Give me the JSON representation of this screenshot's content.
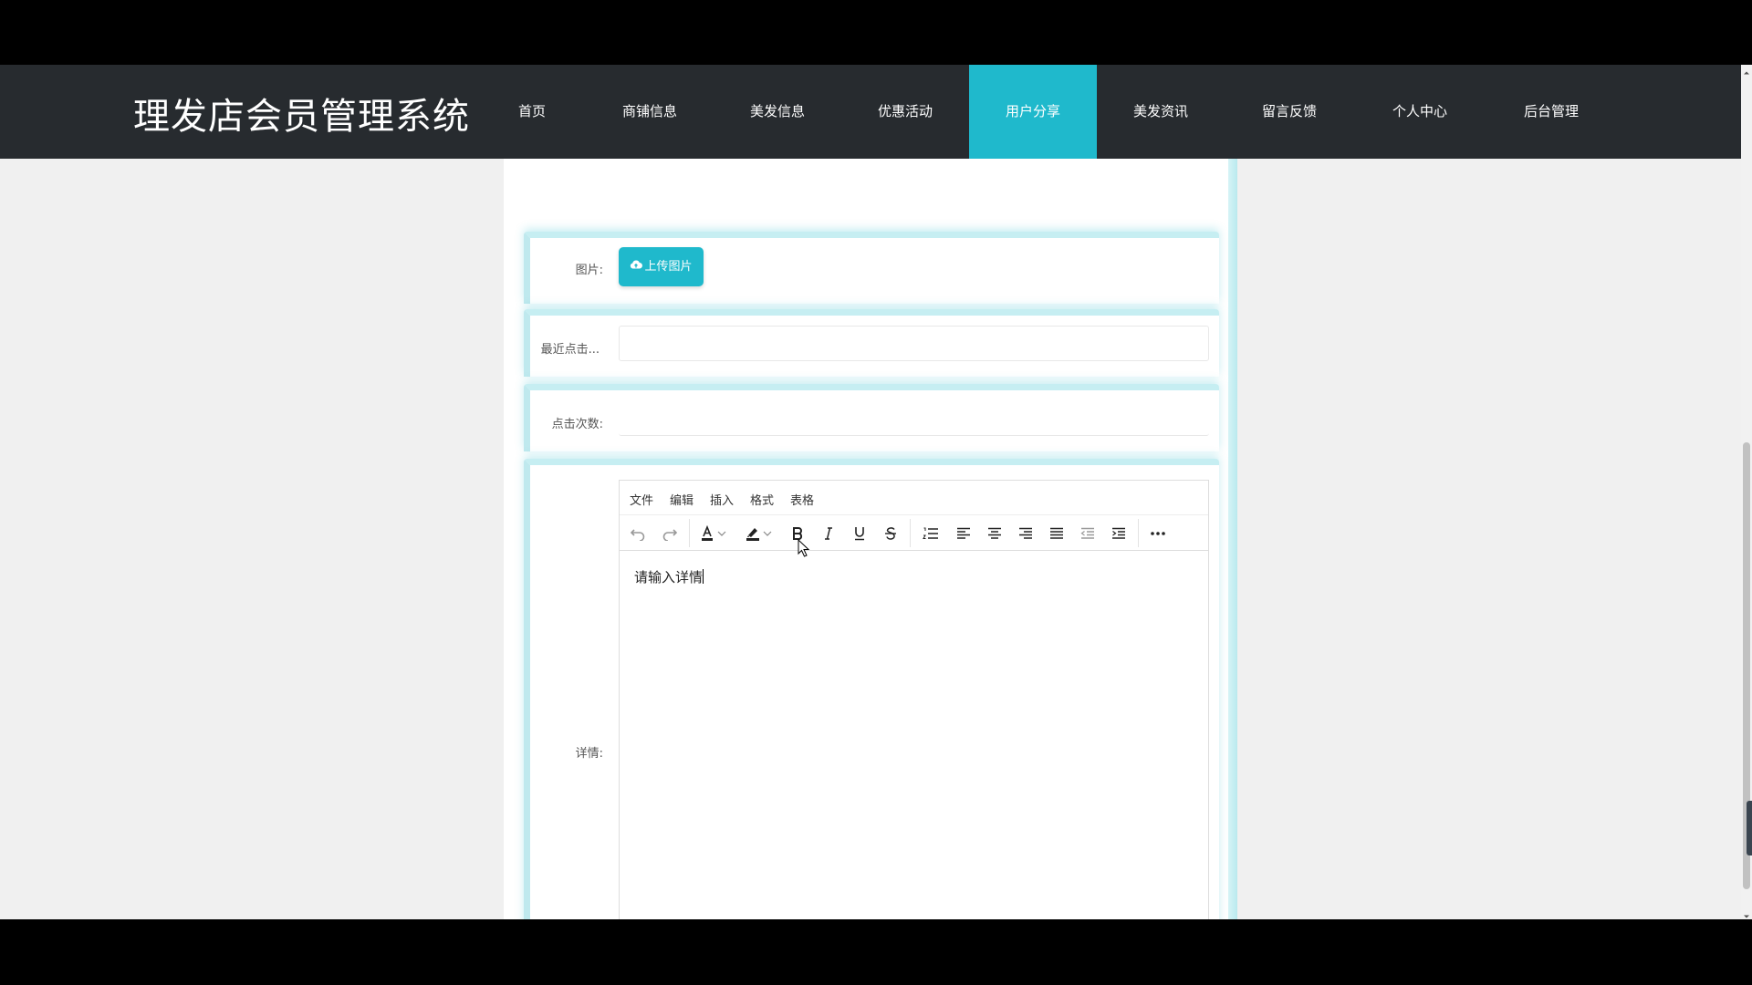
{
  "header": {
    "site_title": "理发店会员管理系统",
    "nav": [
      {
        "label": "首页",
        "active": false
      },
      {
        "label": "商铺信息",
        "active": false
      },
      {
        "label": "美发信息",
        "active": false
      },
      {
        "label": "优惠活动",
        "active": false
      },
      {
        "label": "用户分享",
        "active": true
      },
      {
        "label": "美发资讯",
        "active": false
      },
      {
        "label": "留言反馈",
        "active": false
      },
      {
        "label": "个人中心",
        "active": false
      },
      {
        "label": "后台管理",
        "active": false
      }
    ]
  },
  "form": {
    "image": {
      "label": "图片:",
      "upload_label": "上传图片",
      "icon": "cloud-upload-icon"
    },
    "last_click": {
      "label": "最近点击...",
      "value": ""
    },
    "click_count": {
      "label": "点击次数:",
      "value": ""
    },
    "detail": {
      "label": "详情:"
    }
  },
  "editor": {
    "menus": [
      "文件",
      "编辑",
      "插入",
      "格式",
      "表格"
    ],
    "tools": [
      "undo-icon",
      "redo-icon",
      "font-color-icon",
      "highlight-color-icon",
      "bold-icon",
      "italic-icon",
      "underline-icon",
      "strikethrough-icon",
      "ordered-list-icon",
      "align-left-icon",
      "align-center-icon",
      "align-right-icon",
      "align-justify-icon",
      "outdent-icon",
      "indent-icon",
      "more-icon"
    ],
    "content": "请输入详情"
  },
  "colors": {
    "accent": "#1fb9cc",
    "nav_bg": "#272b2f",
    "page_bg": "#f0f0f0"
  }
}
